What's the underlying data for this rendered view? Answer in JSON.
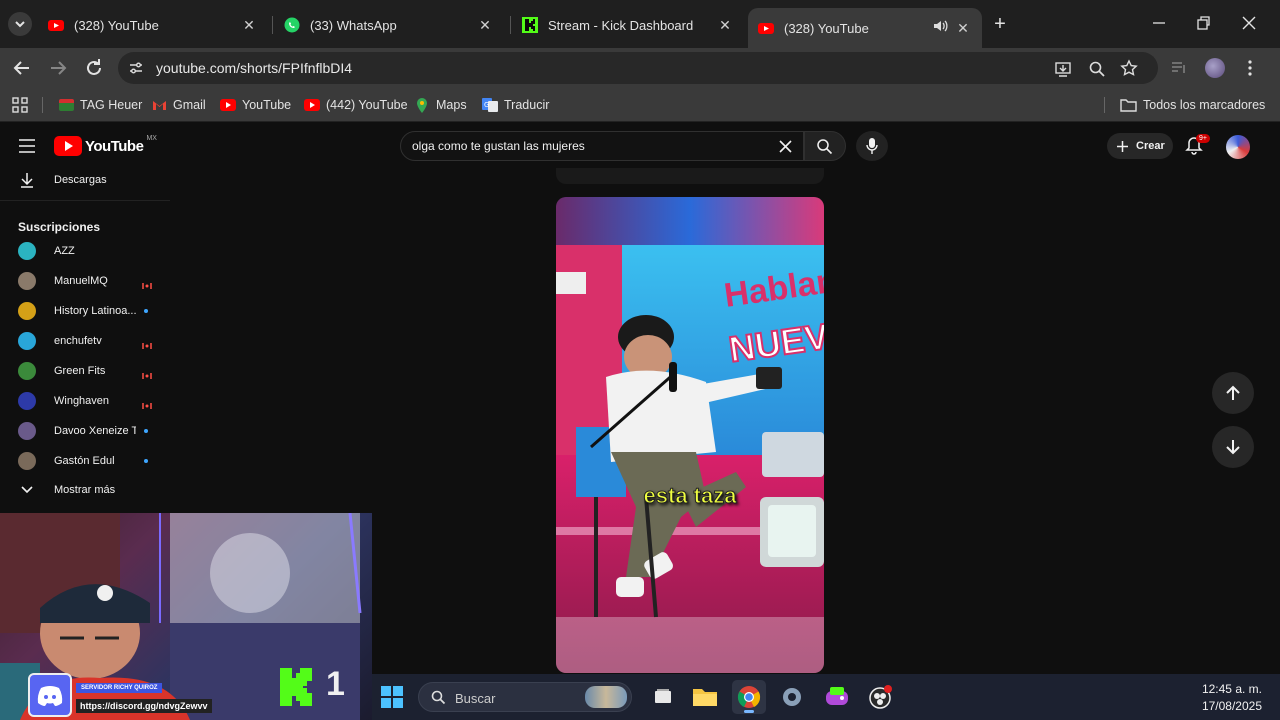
{
  "browser": {
    "tabs": [
      {
        "title": "(328) YouTube",
        "icon": "youtube-icon",
        "active": false
      },
      {
        "title": "(33) WhatsApp",
        "icon": "whatsapp-icon",
        "active": false
      },
      {
        "title": "Stream - Kick Dashboard",
        "icon": "kick-icon",
        "active": false
      },
      {
        "title": "(328) YouTube",
        "icon": "youtube-icon",
        "active": true
      }
    ],
    "url": "youtube.com/shorts/FPIfnflbDI4",
    "bookmarks": [
      {
        "label": "TAG Heuer",
        "color": "#2e7d32"
      },
      {
        "label": "Gmail",
        "color": "#ea4335"
      },
      {
        "label": "YouTube",
        "color": "#ff0000"
      },
      {
        "label": "(442) YouTube",
        "color": "#ff0000"
      },
      {
        "label": "Maps",
        "color": "#34a853"
      },
      {
        "label": "Traducir",
        "color": "#4285f4"
      }
    ],
    "all_bookmarks": "Todos los marcadores"
  },
  "youtube": {
    "logo": "YouTube",
    "region": "MX",
    "search_value": "olga como te gustan las mujeres",
    "create_label": "Crear",
    "notif_badge": "9+",
    "downloads_label": "Descargas",
    "subscriptions_title": "Suscripciones",
    "subscriptions": [
      {
        "name": "AZZ",
        "status": "",
        "color": "#2bb3c0"
      },
      {
        "name": "ManuelMQ",
        "status": "live",
        "color": "#8a7a6a"
      },
      {
        "name": "History Latinoa...",
        "status": "dot",
        "color": "#d4a017"
      },
      {
        "name": "enchufetv",
        "status": "live",
        "color": "#29a6d9"
      },
      {
        "name": "Green Fits",
        "status": "live",
        "color": "#3b8a3b"
      },
      {
        "name": "Winghaven",
        "status": "live",
        "color": "#2d3aa8"
      },
      {
        "name": "Davoo Xeneize T...",
        "status": "dot",
        "color": "#6a5a8a"
      },
      {
        "name": "Gastón Edul",
        "status": "dot",
        "color": "#7a6a5a"
      }
    ],
    "show_more": "Mostrar más",
    "caption": "esta taza",
    "video_bg_text": "Hablan NUEVADI"
  },
  "stream_overlay": {
    "server_label": "SERVIDOR RICHY QUIROZ",
    "discord_link": "https://discord.gg/ndvgZewvv",
    "kick_count": "1"
  },
  "taskbar": {
    "search_placeholder": "Buscar",
    "time": "12:45 a. m.",
    "date": "17/08/2025"
  }
}
